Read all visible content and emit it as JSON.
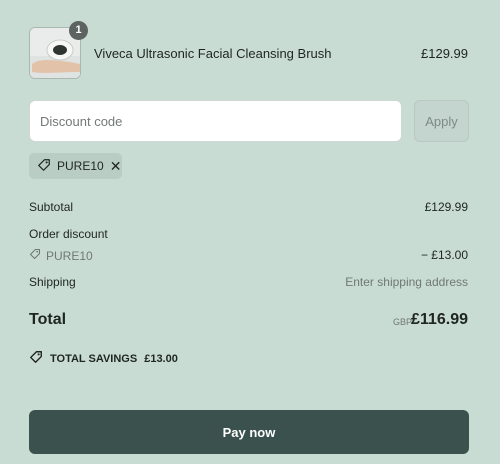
{
  "cart": {
    "item": {
      "name": "Viveca Ultrasonic Facial Cleansing Brush",
      "price": "£129.99",
      "quantity": "1",
      "image_icon": "facial-brush-photo"
    }
  },
  "discount": {
    "placeholder": "Discount code",
    "apply_label": "Apply",
    "applied_code": "PURE10"
  },
  "summary": {
    "subtotal_label": "Subtotal",
    "subtotal_value": "£129.99",
    "order_discount_label": "Order discount",
    "order_discount_code": "PURE10",
    "order_discount_value": "− £13.00",
    "shipping_label": "Shipping",
    "shipping_value": "Enter shipping address",
    "total_label": "Total",
    "total_currency": "GBP",
    "total_value": "£116.99",
    "savings_label": "TOTAL SAVINGS",
    "savings_value": "£13.00"
  },
  "actions": {
    "pay_label": "Pay now"
  },
  "colors": {
    "background": "#c9dcd4",
    "pay_button": "#3a514d",
    "badge": "#5c6360"
  }
}
